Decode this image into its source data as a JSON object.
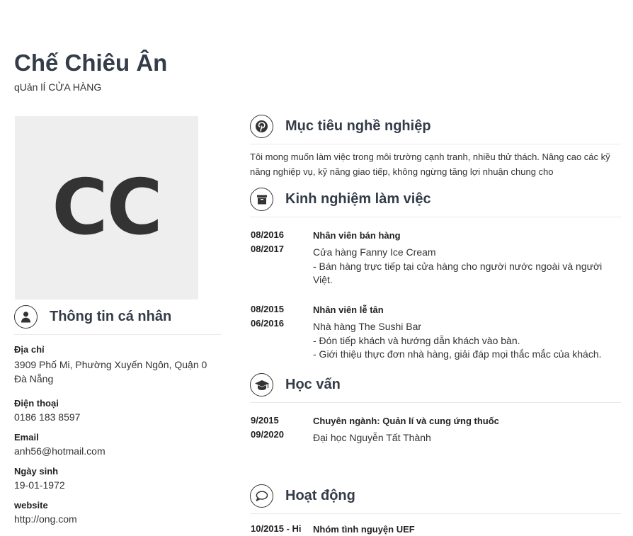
{
  "header": {
    "name": "Chế Chiêu Ân",
    "job_title": "qUản lÍ CỬA HÀNG"
  },
  "avatar": {
    "initials": "CC"
  },
  "personal": {
    "title": "Thông tin cá nhân",
    "address_label": "Địa chỉ",
    "address_line1": "3909 Phố Mi, Phường Xuyến Ngôn, Quận 0",
    "address_line2": "Đà Nẵng",
    "phone_label": "Điện thoại",
    "phone": "0186 183 8597",
    "email_label": "Email",
    "email": "anh56@hotmail.com",
    "birthday_label": "Ngày sinh",
    "birthday": "19-01-1972",
    "website_label": "website",
    "website": "http://ong.com"
  },
  "objective": {
    "title": "Mục tiêu nghề nghiệp",
    "text": "Tôi mong muốn làm việc trong môi trường cạnh tranh, nhiều thử thách. Nâng cao các kỹ năng nghiệp vụ, kỹ năng giao tiếp, không ngừng tăng lợi nhuận chung cho"
  },
  "experience": {
    "title": "Kinh nghiệm làm việc",
    "items": [
      {
        "start": "08/2016",
        "end": "08/2017",
        "position": "Nhân viên bán hàng",
        "company": "Cửa hàng Fanny Ice Cream",
        "details": "- Bán hàng trực tiếp tại cửa hàng cho người nước ngoài và người Việt."
      },
      {
        "start": "08/2015",
        "end": "06/2016",
        "position": "Nhân viên lễ tân",
        "company": "Nhà hàng The Sushi Bar",
        "details1": "- Đón tiếp khách và hướng dẫn khách vào bàn.",
        "details2": "- Giới thiệu thực đơn nhà hàng, giải đáp mọi thắc mắc của khách."
      }
    ]
  },
  "education": {
    "title": "Học vấn",
    "items": [
      {
        "start": "9/2015",
        "end": "09/2020",
        "major": "Chuyên ngành: Quản lí và cung ứng thuốc",
        "school": "Đại học Nguyễn Tất Thành"
      }
    ]
  },
  "activities": {
    "title": "Hoạt động",
    "items": [
      {
        "date": "10/2015 - Hi",
        "name": "Nhóm tình nguyện UEF"
      }
    ]
  },
  "icons": {
    "personal": "user-icon",
    "objective": "pinterest-icon",
    "experience": "archive-box-icon",
    "education": "graduation-cap-icon",
    "activities": "speech-bubble-icon"
  }
}
